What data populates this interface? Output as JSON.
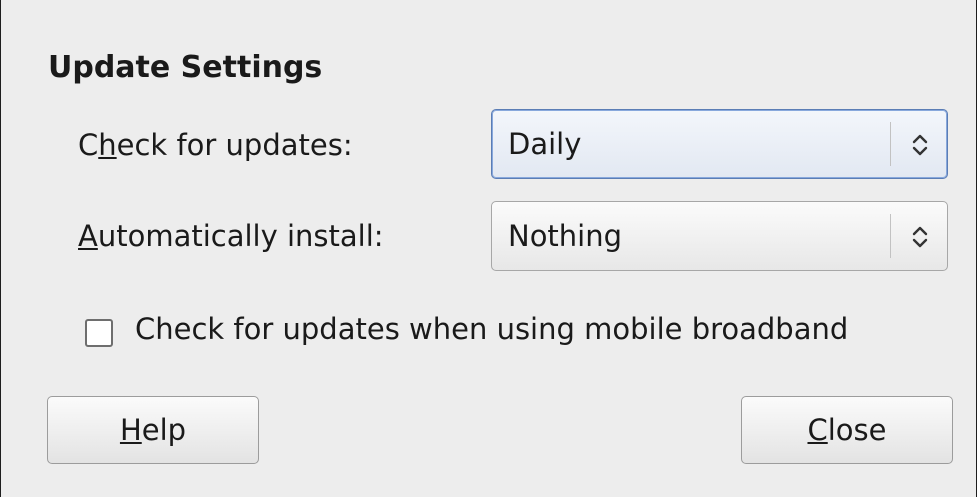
{
  "section": {
    "title": "Update Settings"
  },
  "check_for_updates": {
    "label_mnemonic": "C",
    "label_mid_pre": "",
    "label_prefix": "C",
    "label_underlined": "h",
    "label_suffix": "eck for updates:",
    "selected": "Daily"
  },
  "auto_install": {
    "label_underlined": "A",
    "label_suffix": "utomatically install:",
    "selected": "Nothing"
  },
  "mobile_broadband": {
    "label": "Check for updates when using mobile broadband",
    "checked": false
  },
  "buttons": {
    "help_underlined": "H",
    "help_suffix": "elp",
    "close_underlined": "C",
    "close_suffix": "lose"
  },
  "icons": {
    "combo_arrows": "up-down-chevron-icon"
  },
  "colors": {
    "dialog_bg": "#ededed",
    "focus_border": "#5b7db5"
  }
}
